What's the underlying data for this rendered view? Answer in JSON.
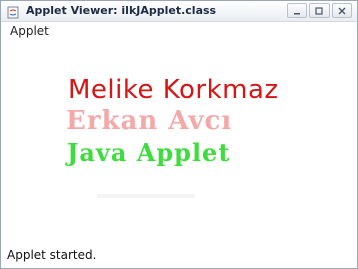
{
  "window": {
    "title": "Applet Viewer: ilkJApplet.class",
    "icon": "java-cup-icon"
  },
  "menu": {
    "items": [
      "Applet"
    ]
  },
  "applet": {
    "lines": [
      {
        "text": "Melike Korkmaz",
        "color": "#d61515"
      },
      {
        "text": "Erkan Avcı",
        "color": "#f4a8a8"
      },
      {
        "text": "Java Applet",
        "color": "#3ddd3d"
      }
    ]
  },
  "status": {
    "text": "Applet started."
  }
}
